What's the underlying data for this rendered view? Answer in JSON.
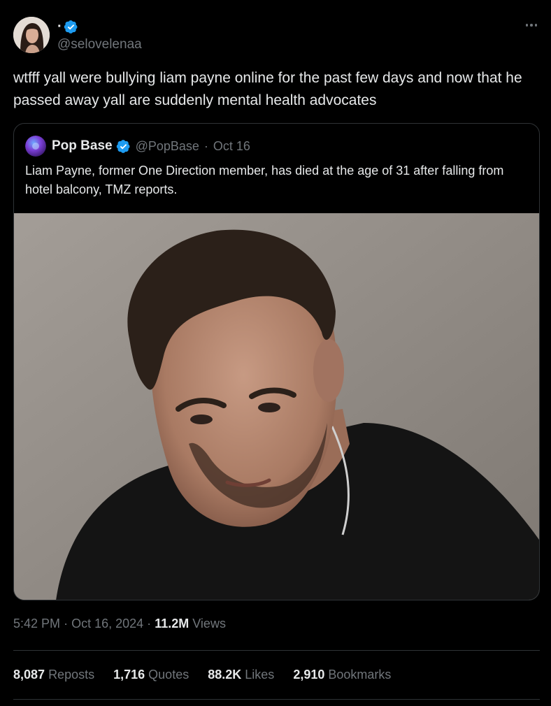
{
  "author": {
    "display_name": "·",
    "handle": "@selovelenaa",
    "avatar_icon": "profile-photo",
    "verified_icon": "verified-badge-icon"
  },
  "tweet": {
    "text": "wtfff yall were bullying liam payne online for the past few days and now that he passed away yall are suddenly mental health advocates"
  },
  "quoted_tweet": {
    "display_name": "Pop Base",
    "handle": "@PopBase",
    "separator": "·",
    "date": "Oct 16",
    "text": "Liam Payne, former One Direction member, has died at the age of 31 after falling from hotel balcony, TMZ reports.",
    "image_alt": "Portrait photo of Liam Payne"
  },
  "meta": {
    "time": "5:42 PM",
    "sep1": "·",
    "date": "Oct 16, 2024",
    "sep2": "·",
    "views_count": "11.2M",
    "views_label": "Views"
  },
  "stats": [
    {
      "count": "8,087",
      "label": "Reposts"
    },
    {
      "count": "1,716",
      "label": "Quotes"
    },
    {
      "count": "88.2K",
      "label": "Likes"
    },
    {
      "count": "2,910",
      "label": "Bookmarks"
    }
  ],
  "colors": {
    "background": "#000000",
    "text_primary": "#e7e9ea",
    "text_secondary": "#71767b",
    "verified_blue": "#1d9bf0",
    "border": "#2f3336"
  }
}
